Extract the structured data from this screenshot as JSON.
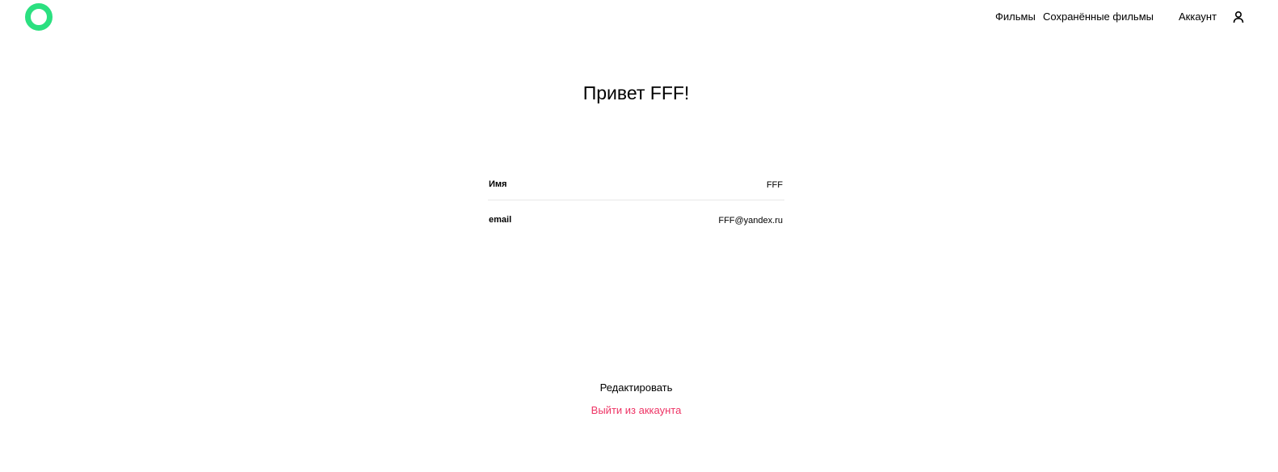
{
  "header": {
    "logo_icon": "ring-logo-icon",
    "logo_color": "#2be080",
    "nav": {
      "films": "Фильмы",
      "saved_films": "Сохранённые фильмы",
      "account": "Аккаунт"
    },
    "account_icon": "user-icon"
  },
  "profile": {
    "greeting": "Привет FFF!",
    "fields": [
      {
        "label": "Имя",
        "value": "FFF"
      },
      {
        "label": "email",
        "value": "FFF@yandex.ru"
      }
    ]
  },
  "actions": {
    "edit_label": "Редактировать",
    "logout_label": "Выйти из аккаунта",
    "logout_color": "#ee3465"
  }
}
